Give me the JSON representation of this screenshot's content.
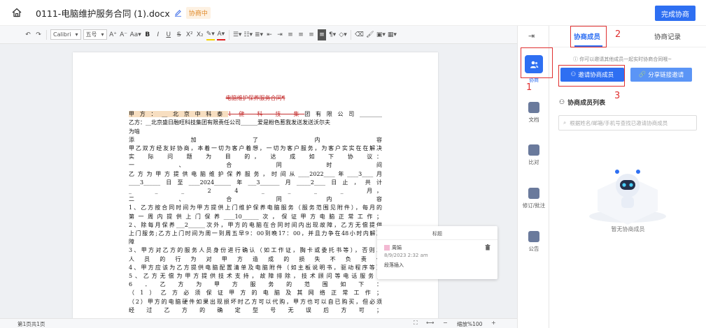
{
  "header": {
    "doc_title": "0111-电脑维护服务合同 (1).docx",
    "status": "协商中",
    "finish_button": "完成协商"
  },
  "toolbar": {
    "font_name": "Calibri",
    "font_size": "五号",
    "bold": "B",
    "italic": "I",
    "underline": "U",
    "strike": "S"
  },
  "document": {
    "heading": "电脑维护保养服务合同¶",
    "lines": [
      {
        "a": "甲方：",
        "b": "__北京中科泰",
        "c": "1 健 科 技 集",
        "d": "团有限公司________"
      },
      {
        "text": "乙方：__北京盛日融旺科技集团有限责任公司______爱是粉色惹我发送发送沃尔夫"
      },
      {
        "text": "为啥"
      },
      {
        "text": "添　　　　　　　加　　　　　　　了　　　　　　　内　　　　　　　容"
      },
      {
        "text": "甲乙双方经友好协商，本着一切为客户着想，一切为客户服务，为客户实实在在解决"
      },
      {
        "text": "实　际　问　题　为　目　的，　达　成　如　下　协　议："
      },
      {
        "text": "一　　　　　　　、　　　　　　　合　　　　　　　同　　　　　　　时　　　　　　　间"
      },
      {
        "text": "乙方为甲方提供电脑维护保养服务，时间从____2022____年____3____月"
      },
      {
        "text": "____3______日至____2024______年___3_______月_____2____日止，共计"
      },
      {
        "text": "_　　_　　_　　2　　4　　_　　_　　_　　_　　月，"
      },
      {
        "text": "二　　　　　　　、　　　　　　　合　　　　　　　同　　　　　　　内　　　　　　　容"
      },
      {
        "text": "1、乙方按合同时间为甲方提供上门维护保养电脑服务（服务范围见附件），每月的"
      },
      {
        "text": "第一周内提供上门保养____10______次，保证甲方电脑正常工作；"
      },
      {
        "text": "2、除每月保养___2______次外，甲方的电脑在合同时间内出现故障，乙方无偿提供"
      },
      {
        "text": "上门服务;乙方上门时间为周一到周五早9：00到晚17：00，并且力争在48小时内解决"
      },
      {
        "text": "障"
      },
      {
        "text": "3、甲方对乙方的服务人员身份进行确认（如工作证，胸卡或委托书等），否则工"
      },
      {
        "text": "人　员　的　行　为　对　甲　方　造　成　的　损　失　不　负　责　任"
      },
      {
        "text": "4、甲方应该为乙方提供电脑配置清单及电脑附件（如主板说明书，驱动程序等）"
      },
      {
        "text": "5、乙方无偿为甲方提供技术支持，故障排除，技术顾问等电话服务；"
      },
      {
        "text": "6　．　乙　方　为　甲　方　服　务　的　范　围　如　下　："
      },
      {
        "text": "（1）乙方必须保证甲方的电脑及其网络正常工作；"
      },
      {
        "text": "（2）甲方的电脑硬件如果出现损坏时乙方可以代购，甲方也可以自已购买，但必须"
      },
      {
        "text": "经　过　乙　方　的　确　定　型　号　无　误　后　方　可　；"
      }
    ]
  },
  "comment": {
    "title": "标题",
    "user": "周娟",
    "time": "8/9/2023 2:32 am",
    "action": "段落插入"
  },
  "statusbar": {
    "page_count": "第1页共1页",
    "zoom": "缩放%100"
  },
  "strip": {
    "collab": "协商",
    "doc": "文档",
    "compare": "比对",
    "revise": "修订/批注",
    "notice": "公告"
  },
  "annotations": {
    "n1": "1",
    "n2": "2",
    "n3": "3"
  },
  "panel": {
    "tab_members": "协商成员",
    "tab_records": "协商记录",
    "info": "ⓘ 你可以邀请其他成员一起实时协商合同哦~",
    "invite_button": "邀请协商成员",
    "share_button": "分享链接邀请",
    "list_title": "协商成员列表",
    "search_placeholder": "根据姓名/邮箱/手机号查找已邀请协商成员",
    "empty_text": "暂无协商成员"
  },
  "colors": {
    "accent": "#2e6ff2",
    "annotation_red": "#e03030"
  }
}
